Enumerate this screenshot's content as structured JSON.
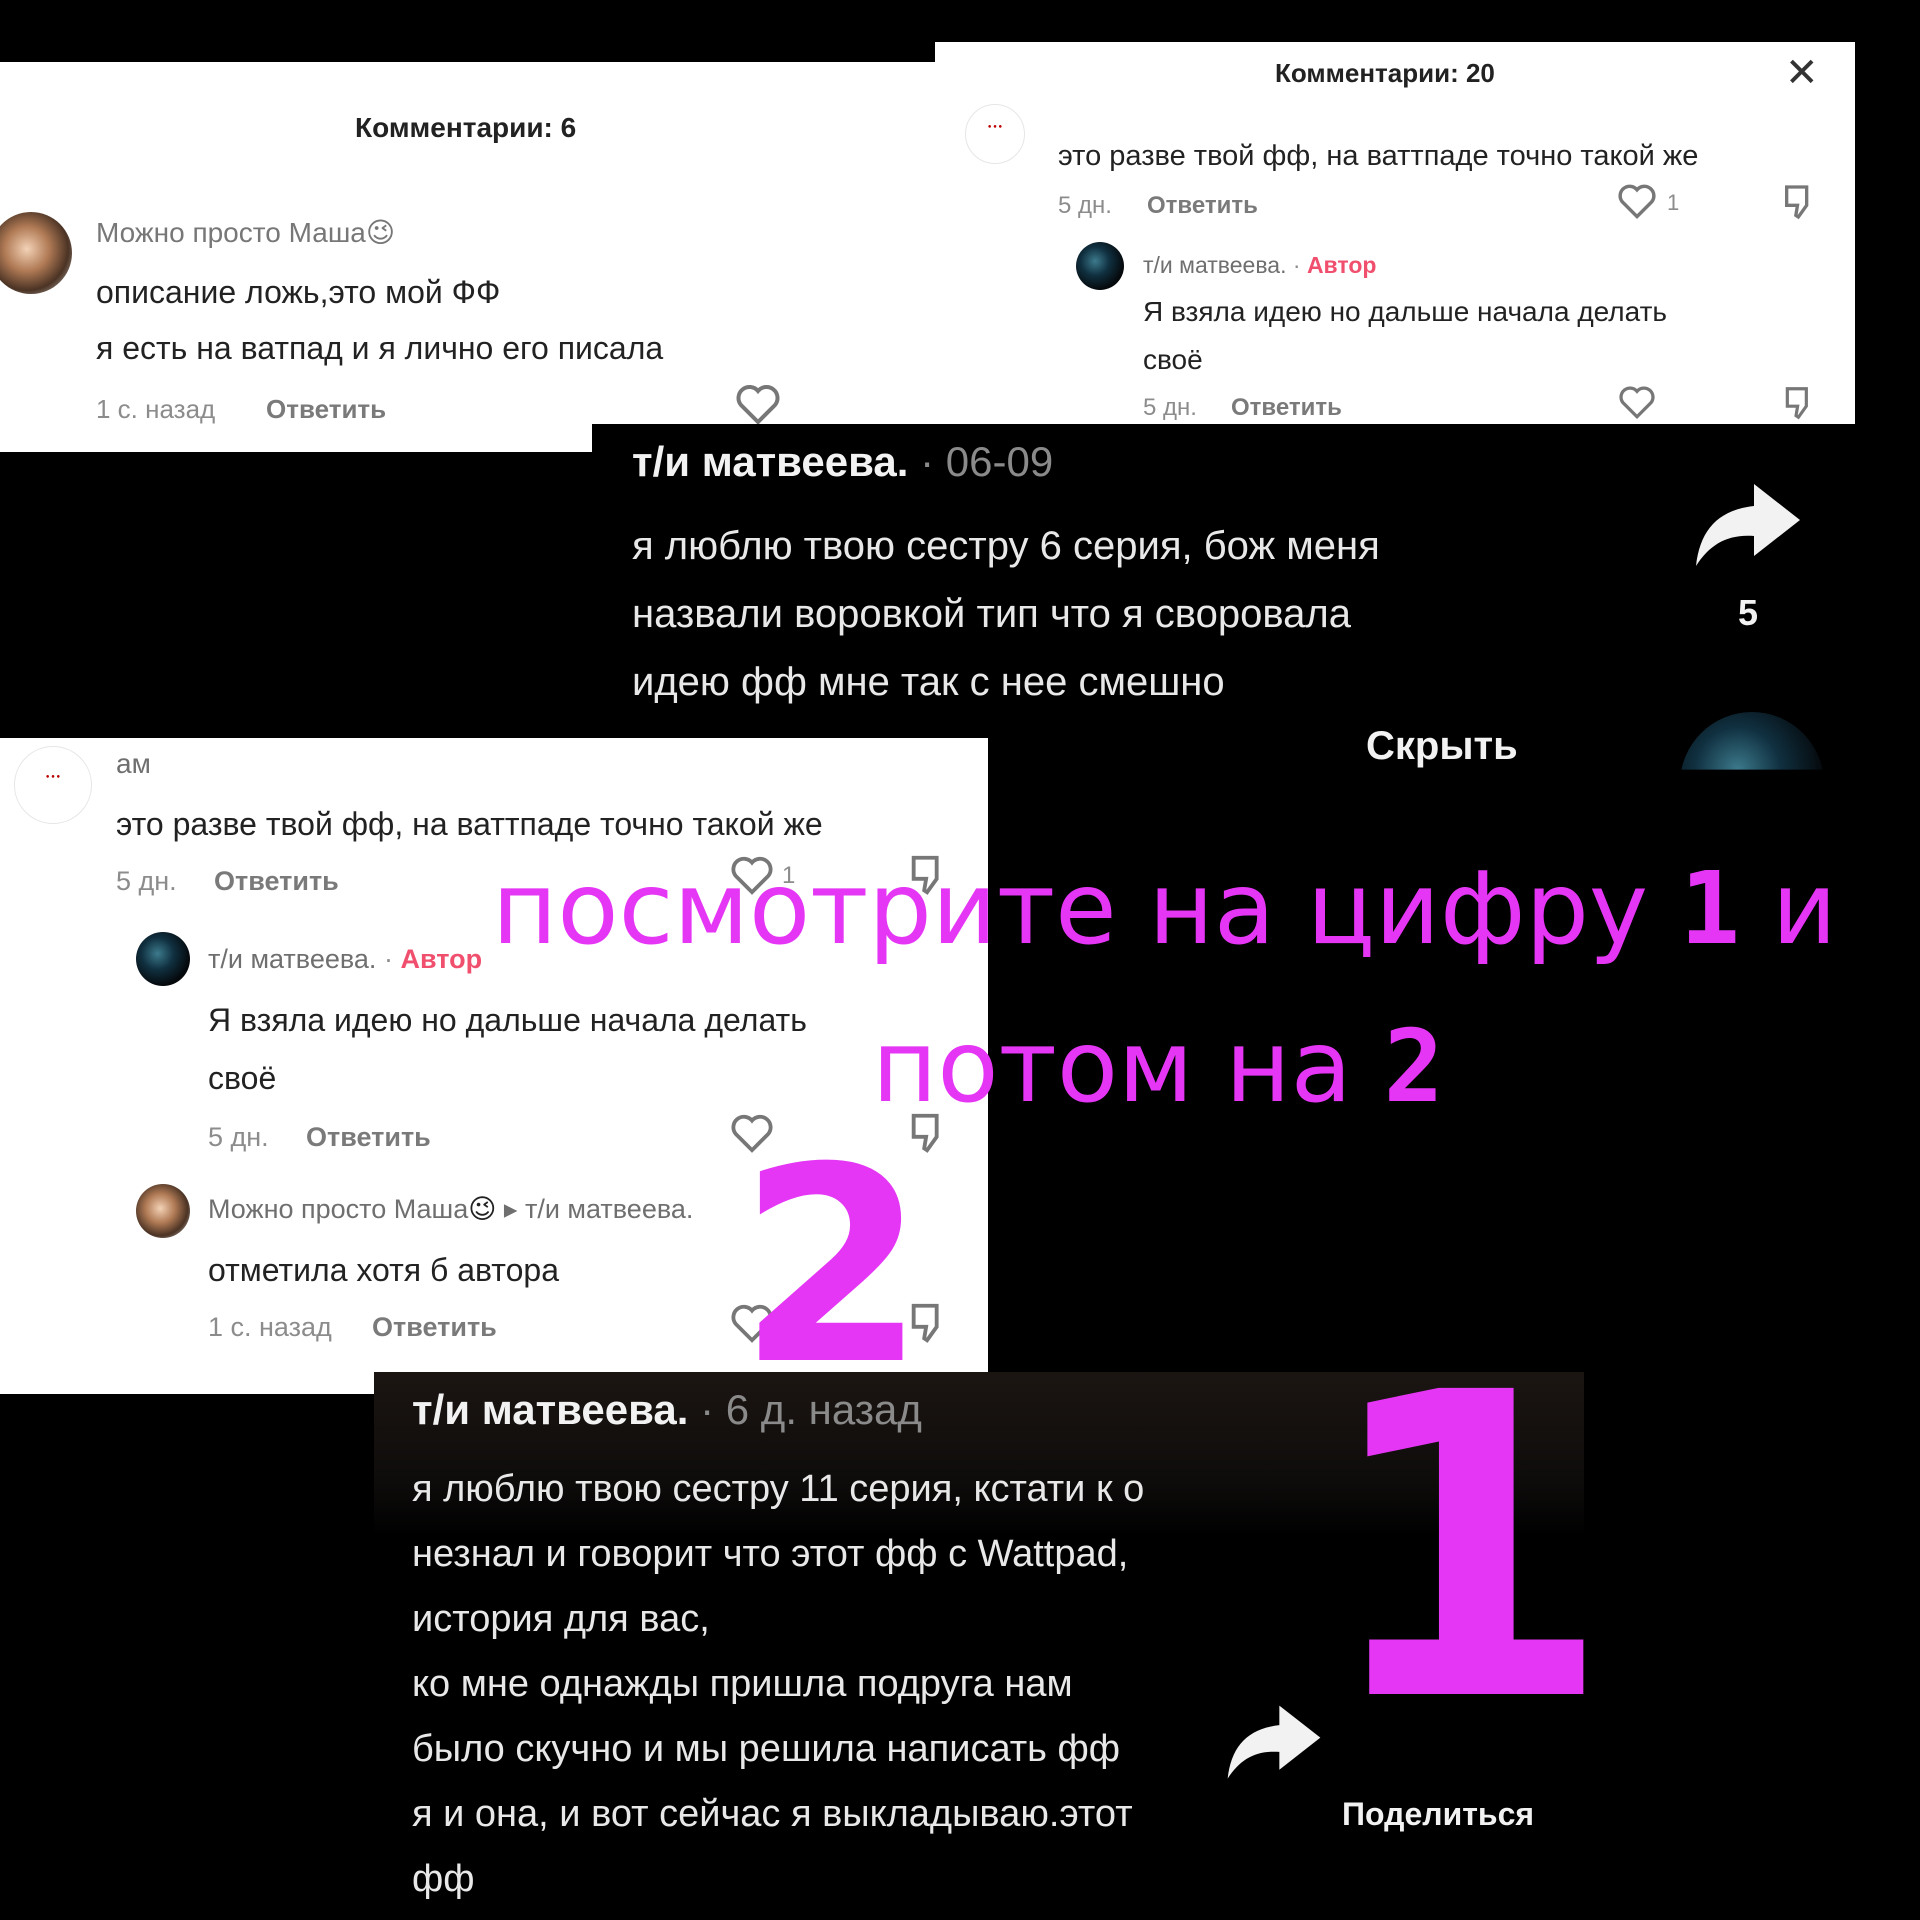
{
  "panel_a": {
    "header": "Комментарии: 6",
    "comment": {
      "username": "Можно просто Маша",
      "emoji": "😉",
      "line1": "описание ложь,это мой ФФ",
      "line2": "я есть на ватпад и я лично его писала",
      "time": "1 с. назад",
      "reply": "Ответить"
    }
  },
  "panel_b": {
    "header": "Комментарии: 20",
    "comment": {
      "text": "это разве твой фф, на ваттпаде точно такой же",
      "time": "5 дн.",
      "reply": "Ответить",
      "likes": "1"
    },
    "reply_comment": {
      "username": "т/и матвеева.",
      "separator": "·",
      "author_tag": "Автор",
      "line1": "Я взяла идею но дальше начала делать",
      "line2": "своё",
      "time": "5 дн.",
      "reply": "Ответить"
    }
  },
  "video_top": {
    "username": "т/и матвеева.",
    "date": "· 06-09",
    "line1": "я люблю твою сестру 6 серия, бож меня",
    "line2": "назвали воровкой тип что я своровала",
    "line3": "идею фф мне так с нее смешно",
    "hide": "Скрыть",
    "share_count": "5"
  },
  "panel_c": {
    "username": "ам",
    "comment": {
      "text": "это разве твой фф, на ваттпаде точно такой же",
      "time": "5 дн.",
      "reply": "Ответить",
      "likes": "1"
    },
    "reply1": {
      "username": "т/и матвеева.",
      "separator": "·",
      "author_tag": "Автор",
      "line1": "Я взяла идею но дальше начала делать",
      "line2": "своё",
      "time": "5 дн.",
      "reply": "Ответить"
    },
    "reply2": {
      "username": "Можно просто Маша",
      "emoji": "😉",
      "arrow": "▸",
      "target": "т/и матвеева.",
      "text": "отметила хотя б автора",
      "time": "1 с. назад",
      "reply": "Ответить"
    }
  },
  "video_bottom": {
    "username": "т/и матвеева.",
    "date": "· 6 д. назад",
    "lines": [
      "я люблю твою сестру 11 серия, кстати к о",
      "незнал и говорит что этот фф с Wattpad,",
      "история для вас,",
      "ко мне однажды пришла подруга нам",
      "было скучно и мы решила написать фф",
      "я и она, и вот сейчас я выкладываю.этот",
      "фф"
    ],
    "share_label": "Поделиться"
  },
  "overlay": {
    "line1_text": "посмотрите на цифру ",
    "line1_num": "1",
    "line1_end": " и",
    "line2_text": "потом на ",
    "line2_num": "2",
    "big_two": "2",
    "big_one": "1"
  },
  "colors": {
    "magenta": "#e535f5",
    "author_red": "#f0506e",
    "background": "#000000"
  }
}
